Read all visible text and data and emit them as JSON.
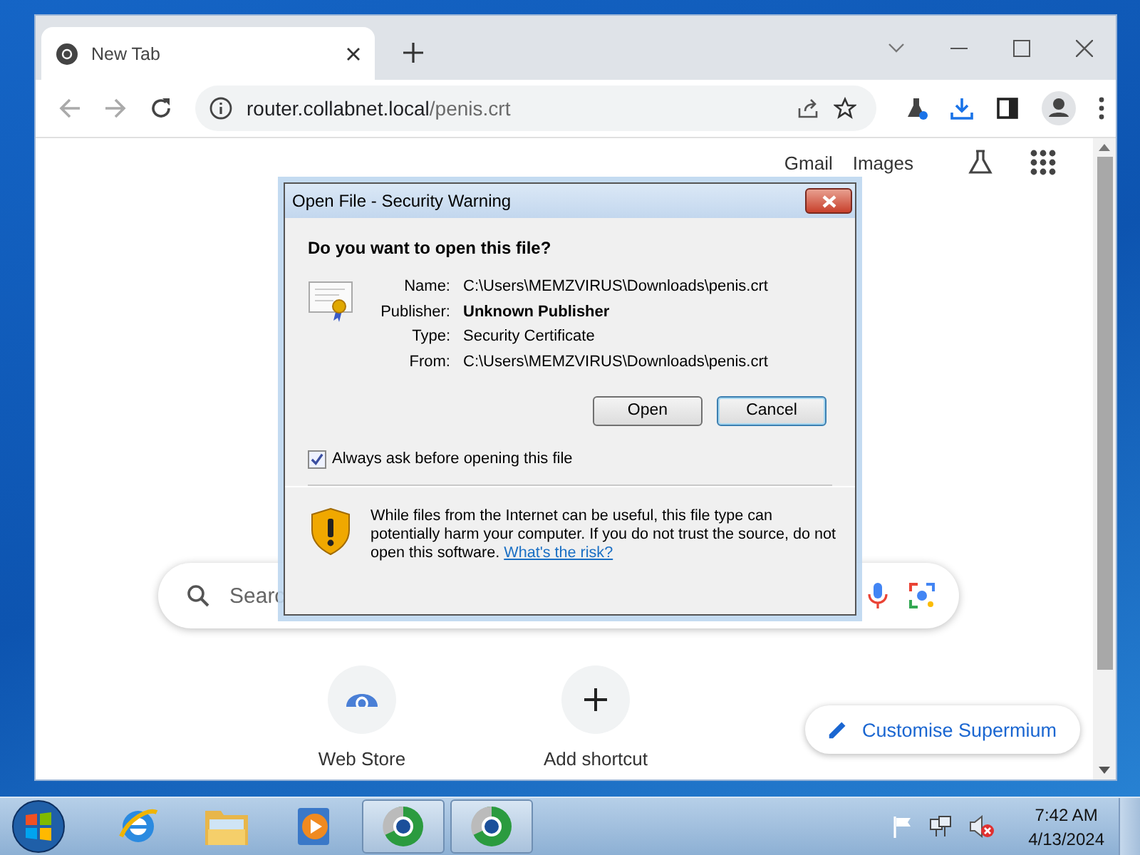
{
  "browser": {
    "tabs": [
      {
        "title": "New Tab",
        "selected": true
      }
    ],
    "address": {
      "host": "router.collabnet.local",
      "path": "/penis.crt"
    }
  },
  "page": {
    "top_links": [
      "Gmail",
      "Images"
    ],
    "search": {
      "placeholder": "Searc"
    },
    "shortcuts": [
      {
        "label": "Web Store",
        "kind": "store"
      },
      {
        "label": "Add shortcut",
        "kind": "add"
      }
    ],
    "customise_button": "Customise Supermium"
  },
  "dialog": {
    "title": "Open File - Security Warning",
    "question": "Do you want to open this file?",
    "fields": [
      {
        "label": "Name:",
        "value": "C:\\Users\\MEMZVIRUS\\Downloads\\penis.crt",
        "bold": false
      },
      {
        "label": "Publisher:",
        "value": "Unknown Publisher",
        "bold": true
      },
      {
        "label": "Type:",
        "value": "Security Certificate",
        "bold": false
      },
      {
        "label": "From:",
        "value": "C:\\Users\\MEMZVIRUS\\Downloads\\penis.crt",
        "bold": false
      }
    ],
    "buttons": [
      {
        "label": "Open",
        "default": false
      },
      {
        "label": "Cancel",
        "default": true
      }
    ],
    "always_ask": {
      "label": "Always ask before opening this file",
      "checked": true
    },
    "warning": "While files from the Internet can be useful, this file type can potentially harm your computer. If you do not trust the source, do not open this software.",
    "risk_link": "What's the risk?"
  },
  "taskbar": {
    "apps": [
      {
        "kind": "ie",
        "open": false
      },
      {
        "kind": "explorer",
        "open": false
      },
      {
        "kind": "media",
        "open": false
      },
      {
        "kind": "browser",
        "open": true
      },
      {
        "kind": "browser",
        "open": true
      }
    ],
    "time": "7:42 AM",
    "date": "4/13/2024"
  }
}
